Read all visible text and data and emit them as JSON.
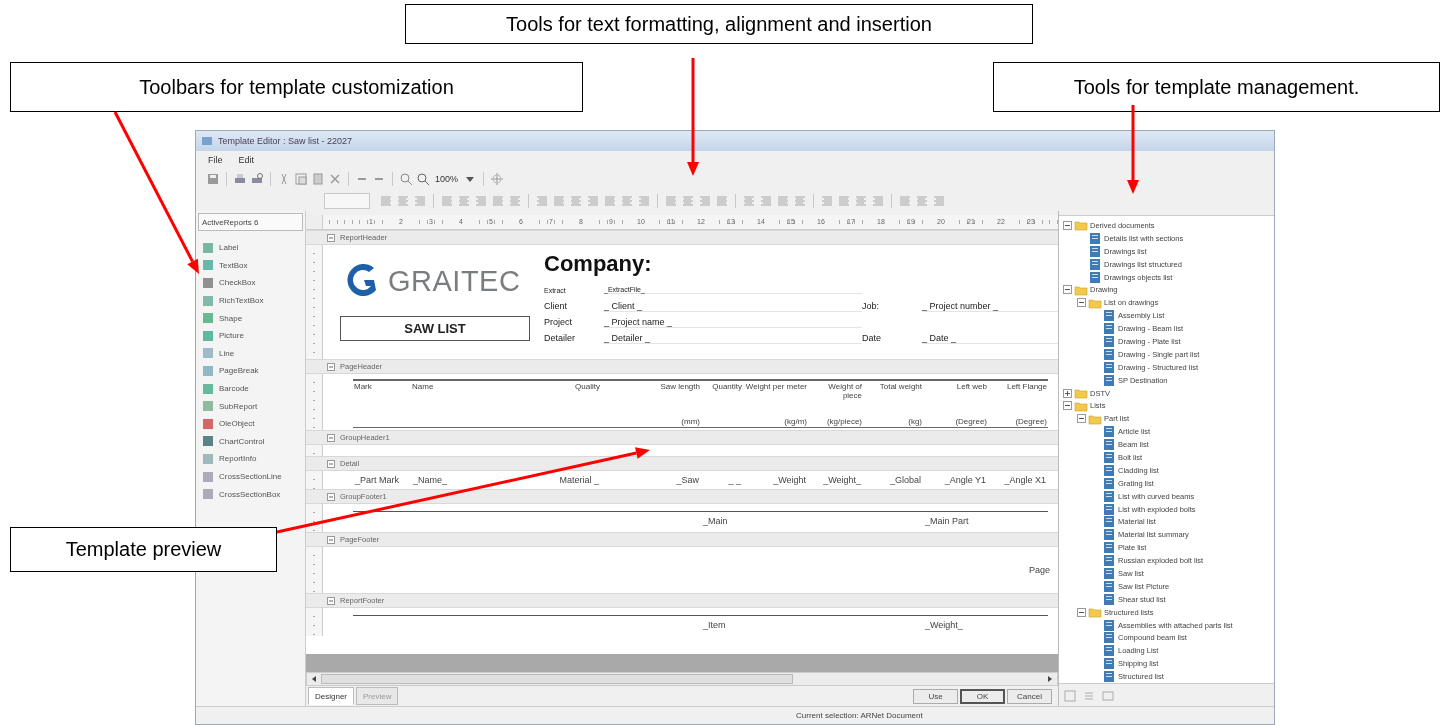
{
  "callouts": [
    {
      "text": "Tools for text formatting, alignment and insertion"
    },
    {
      "text": "Toolbars for template customization"
    },
    {
      "text": "Tools for template management."
    },
    {
      "text": "Template preview"
    }
  ],
  "window": {
    "title": "Template Editor : Saw list - 22027"
  },
  "menu": [
    "File",
    "Edit"
  ],
  "toolbar": {
    "zoom": "100%"
  },
  "toolbox": {
    "title": "ActiveReports 6",
    "items": [
      "Label",
      "TextBox",
      "CheckBox",
      "RichTextBox",
      "Shape",
      "Picture",
      "Line",
      "PageBreak",
      "Barcode",
      "SubReport",
      "OleObject",
      "ChartControl",
      "ReportInfo",
      "CrossSectionLine",
      "CrossSectionBox"
    ]
  },
  "ruler": {
    "labels": [
      "1",
      "2",
      "3",
      "4",
      "5",
      "6",
      "7",
      "8",
      "9",
      "10",
      "11",
      "12",
      "13",
      "14",
      "15",
      "16",
      "17",
      "18",
      "19",
      "20",
      "21",
      "22",
      "23"
    ]
  },
  "sections": [
    {
      "title": "ReportHeader",
      "kind": "report_header",
      "logo": "GRAITEC",
      "title_box": "SAW LIST",
      "company": "Company:",
      "rows": [
        {
          "kind": "small",
          "label": "Extract",
          "value": "_ExtractFile_"
        },
        {
          "kind": "normal",
          "label": "Client",
          "value": "_ Client _",
          "side_label": "Job:",
          "side_value": "_ Project number _"
        },
        {
          "kind": "normal",
          "label": "Project",
          "value": "_ Project name _"
        },
        {
          "kind": "normal",
          "label": "Detailer",
          "value": "_ Detailer _",
          "side_label": "Date",
          "side_value": "_ Date _"
        }
      ]
    },
    {
      "title": "PageHeader",
      "kind": "column_headers",
      "columns": [
        {
          "label": "Mark"
        },
        {
          "label": "Name"
        },
        {
          "label": "Quality"
        },
        {
          "label": "Saw length",
          "unit": "(mm)"
        },
        {
          "label": "Quantity"
        },
        {
          "label": "Weight per meter",
          "unit": "(kg/m)"
        },
        {
          "label": "Weight of piece",
          "unit": "(kg/piece)"
        },
        {
          "label": "Total weight",
          "unit": "(kg)"
        },
        {
          "label": "Left web",
          "unit": "(Degree)"
        },
        {
          "label": "Left Flange",
          "unit": "(Degree)"
        }
      ]
    },
    {
      "title": "GroupHeader1",
      "kind": "empty"
    },
    {
      "title": "Detail",
      "kind": "fields",
      "fields": [
        "_Part Mark",
        "_Name_",
        "Material _",
        "_Saw",
        "_ _",
        "_Weight",
        "_Weight_",
        "_Global",
        "_Angle Y1",
        "_Angle X1"
      ]
    },
    {
      "title": "GroupFooter1",
      "kind": "totals",
      "fields": [
        "_Main",
        "_Main Part"
      ]
    },
    {
      "title": "PageFooter",
      "kind": "page_footer",
      "fields": [
        "Page"
      ]
    },
    {
      "title": "ReportFooter",
      "kind": "totals",
      "fields": [
        "_Item",
        "_Weight_"
      ]
    }
  ],
  "tree": {
    "items": [
      {
        "label": "Derived documents",
        "kind": "folder",
        "expanded": true,
        "children": [
          {
            "label": "Details list with sections",
            "kind": "report"
          },
          {
            "label": "Drawings list",
            "kind": "report"
          },
          {
            "label": "Drawings list structured",
            "kind": "report"
          },
          {
            "label": "Drawings objects list",
            "kind": "report"
          }
        ]
      },
      {
        "label": "Drawing",
        "kind": "folder",
        "expanded": true,
        "children": [
          {
            "label": "List on drawings",
            "kind": "folder",
            "expanded": true,
            "children": [
              {
                "label": "Assembly List",
                "kind": "report"
              },
              {
                "label": "Drawing - Beam list",
                "kind": "report"
              },
              {
                "label": "Drawing - Plate list",
                "kind": "report"
              },
              {
                "label": "Drawing - Single part list",
                "kind": "report"
              },
              {
                "label": "Drawing - Structured list",
                "kind": "report"
              },
              {
                "label": "SP Destination",
                "kind": "report"
              }
            ]
          }
        ]
      },
      {
        "label": "DSTV",
        "kind": "folder",
        "expanded": false
      },
      {
        "label": "Lists",
        "kind": "folder",
        "expanded": true,
        "children": [
          {
            "label": "Part list",
            "kind": "folder",
            "expanded": true,
            "children": [
              {
                "label": "Article list",
                "kind": "report"
              },
              {
                "label": "Beam list",
                "kind": "report"
              },
              {
                "label": "Bolt list",
                "kind": "report"
              },
              {
                "label": "Cladding list",
                "kind": "report"
              },
              {
                "label": "Grating list",
                "kind": "report"
              },
              {
                "label": "List with curved beams",
                "kind": "report"
              },
              {
                "label": "List with exploded bolts",
                "kind": "report"
              },
              {
                "label": "Material list",
                "kind": "report"
              },
              {
                "label": "Material list summary",
                "kind": "report"
              },
              {
                "label": "Plate list",
                "kind": "report"
              },
              {
                "label": "Russian exploded bolt list",
                "kind": "report"
              },
              {
                "label": "Saw list",
                "kind": "report"
              },
              {
                "label": "Saw list Picture",
                "kind": "report"
              },
              {
                "label": "Shear stud list",
                "kind": "report"
              }
            ]
          },
          {
            "label": "Structured lists",
            "kind": "folder",
            "expanded": true,
            "children": [
              {
                "label": "Assemblies with attached parts list",
                "kind": "report"
              },
              {
                "label": "Compound beam list",
                "kind": "report"
              },
              {
                "label": "Loading List",
                "kind": "report"
              },
              {
                "label": "Shipping list",
                "kind": "report"
              },
              {
                "label": "Structured list",
                "kind": "report"
              }
            ]
          }
        ]
      }
    ]
  },
  "tabs": [
    {
      "label": "Designer",
      "selected": true
    },
    {
      "label": "Preview",
      "selected": false
    }
  ],
  "buttons": [
    "Use",
    "OK",
    "Cancel"
  ],
  "status_bar": "Current selection: ARNet Document"
}
